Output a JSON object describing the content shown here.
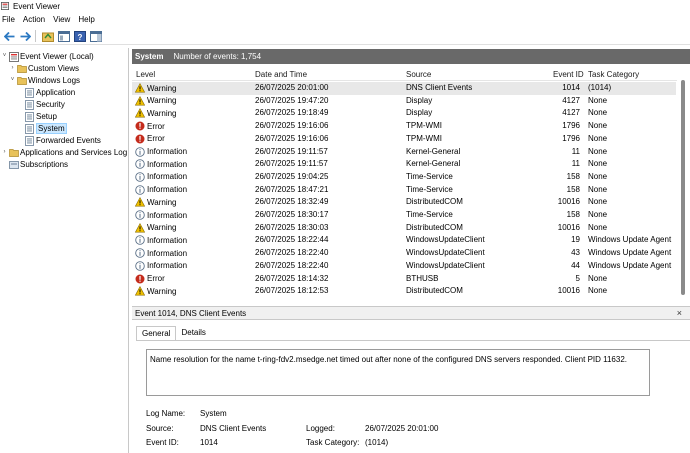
{
  "window": {
    "title": "Event Viewer"
  },
  "menu": [
    "File",
    "Action",
    "View",
    "Help"
  ],
  "toolbar": {
    "icons": [
      "back-arrow-icon",
      "forward-arrow-icon",
      "folder-icon",
      "properties-icon",
      "help-icon",
      "panel-icon"
    ]
  },
  "tree": [
    {
      "label": "Event Viewer (Local)",
      "arrow": "˅",
      "icon": "event-viewer-icon",
      "indent": 0
    },
    {
      "label": "Custom Views",
      "arrow": "›",
      "icon": "folder-icon",
      "indent": 1
    },
    {
      "label": "Windows Logs",
      "arrow": "˅",
      "icon": "folder-icon",
      "indent": 1
    },
    {
      "label": "Application",
      "arrow": "",
      "icon": "log-icon",
      "indent": 2
    },
    {
      "label": "Security",
      "arrow": "",
      "icon": "log-icon",
      "indent": 2
    },
    {
      "label": "Setup",
      "arrow": "",
      "icon": "log-icon",
      "indent": 2
    },
    {
      "label": "System",
      "arrow": "",
      "icon": "log-icon",
      "indent": 2,
      "selected": true
    },
    {
      "label": "Forwarded Events",
      "arrow": "",
      "icon": "log-icon",
      "indent": 2
    },
    {
      "label": "Applications and Services Log",
      "arrow": "›",
      "icon": "folder-icon",
      "indent": 0
    },
    {
      "label": "Subscriptions",
      "arrow": "",
      "icon": "subscriptions-icon",
      "indent": 0
    }
  ],
  "events_header": {
    "log_name": "System",
    "count_text": "Number of events: 1,754"
  },
  "columns": {
    "level": "Level",
    "date": "Date and Time",
    "source": "Source",
    "event_id": "Event ID",
    "task": "Task Category"
  },
  "events": [
    {
      "level": "Warning",
      "date": "26/07/2025 20:01:00",
      "source": "DNS Client Events",
      "event_id": "1014",
      "task": "(1014)",
      "selected": true
    },
    {
      "level": "Warning",
      "date": "26/07/2025 19:47:20",
      "source": "Display",
      "event_id": "4127",
      "task": "None"
    },
    {
      "level": "Warning",
      "date": "26/07/2025 19:18:49",
      "source": "Display",
      "event_id": "4127",
      "task": "None"
    },
    {
      "level": "Error",
      "date": "26/07/2025 19:16:06",
      "source": "TPM-WMI",
      "event_id": "1796",
      "task": "None"
    },
    {
      "level": "Error",
      "date": "26/07/2025 19:16:06",
      "source": "TPM-WMI",
      "event_id": "1796",
      "task": "None"
    },
    {
      "level": "Information",
      "date": "26/07/2025 19:11:57",
      "source": "Kernel-General",
      "event_id": "11",
      "task": "None"
    },
    {
      "level": "Information",
      "date": "26/07/2025 19:11:57",
      "source": "Kernel-General",
      "event_id": "11",
      "task": "None"
    },
    {
      "level": "Information",
      "date": "26/07/2025 19:04:25",
      "source": "Time-Service",
      "event_id": "158",
      "task": "None"
    },
    {
      "level": "Information",
      "date": "26/07/2025 18:47:21",
      "source": "Time-Service",
      "event_id": "158",
      "task": "None"
    },
    {
      "level": "Warning",
      "date": "26/07/2025 18:32:49",
      "source": "DistributedCOM",
      "event_id": "10016",
      "task": "None"
    },
    {
      "level": "Information",
      "date": "26/07/2025 18:30:17",
      "source": "Time-Service",
      "event_id": "158",
      "task": "None"
    },
    {
      "level": "Warning",
      "date": "26/07/2025 18:30:03",
      "source": "DistributedCOM",
      "event_id": "10016",
      "task": "None"
    },
    {
      "level": "Information",
      "date": "26/07/2025 18:22:44",
      "source": "WindowsUpdateClient",
      "event_id": "19",
      "task": "Windows Update Agent"
    },
    {
      "level": "Information",
      "date": "26/07/2025 18:22:40",
      "source": "WindowsUpdateClient",
      "event_id": "43",
      "task": "Windows Update Agent"
    },
    {
      "level": "Information",
      "date": "26/07/2025 18:22:40",
      "source": "WindowsUpdateClient",
      "event_id": "44",
      "task": "Windows Update Agent"
    },
    {
      "level": "Error",
      "date": "26/07/2025 18:14:32",
      "source": "BTHUSB",
      "event_id": "5",
      "task": "None"
    },
    {
      "level": "Warning",
      "date": "26/07/2025 18:12:53",
      "source": "DistributedCOM",
      "event_id": "10016",
      "task": "None"
    }
  ],
  "detail": {
    "header": "Event 1014, DNS Client Events",
    "close_glyph": "×",
    "tabs": [
      "General",
      "Details"
    ],
    "description": "Name resolution for the name t-ring-fdv2.msedge.net timed out after none of the configured DNS servers responded. Client PID 11632.",
    "log_name_label": "Log Name:",
    "log_name_value": "System",
    "source_label": "Source:",
    "source_value": "DNS Client Events",
    "logged_label": "Logged:",
    "logged_value": "26/07/2025 20:01:00",
    "event_id_label": "Event ID:",
    "event_id_value": "1014",
    "task_label": "Task Category:",
    "task_value": "(1014)"
  },
  "colors": {
    "header_bg": "#696969",
    "selection": "#cce8ff",
    "warning": "#f2c200",
    "error": "#c42b1c",
    "info": "#5a6f87"
  }
}
